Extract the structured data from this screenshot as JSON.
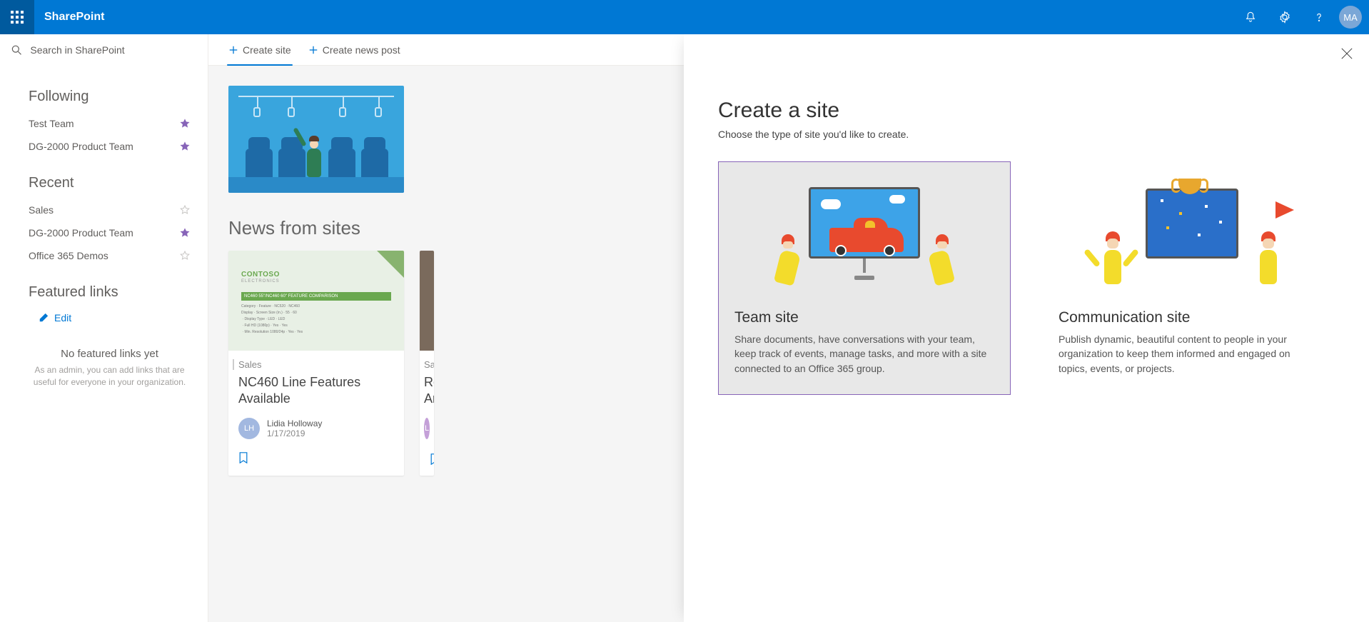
{
  "suitebar": {
    "brand": "SharePoint",
    "avatar_initials": "MA"
  },
  "search": {
    "placeholder": "Search in SharePoint"
  },
  "nav": {
    "following_heading": "Following",
    "recent_heading": "Recent",
    "featured_heading": "Featured links",
    "edit_label": "Edit",
    "following": [
      {
        "label": "Test Team",
        "starred": true
      },
      {
        "label": "DG-2000 Product Team",
        "starred": true
      }
    ],
    "recent": [
      {
        "label": "Sales",
        "starred": false
      },
      {
        "label": "DG-2000 Product Team",
        "starred": true
      },
      {
        "label": "Office 365 Demos",
        "starred": false
      }
    ],
    "nofeatured_title": "No featured links yet",
    "nofeatured_body": "As an admin, you can add links that are useful for everyone in your organization."
  },
  "commands": {
    "create_site": "Create site",
    "create_news": "Create news post"
  },
  "news": {
    "heading": "News from sites",
    "card1": {
      "thumb_logo": "CONTOSO",
      "thumb_sub": "ELECTRONICS",
      "thumb_band": "NC460 55\"/NC460 60\" FEATURE COMPARISON",
      "site": "Sales",
      "title": "NC460 Line Features Available",
      "author": "Lidia Holloway",
      "author_initials": "LH",
      "date": "1/17/2019"
    },
    "card2": {
      "site": "Sa",
      "title_frag1": "Re",
      "title_frag2": "Ar"
    }
  },
  "panel": {
    "title": "Create a site",
    "subtitle": "Choose the type of site you'd like to create.",
    "team": {
      "title": "Team site",
      "desc": "Share documents, have conversations with your team, keep track of events, manage tasks, and more with a site connected to an Office 365 group."
    },
    "comm": {
      "title": "Communication site",
      "desc": "Publish dynamic, beautiful content to people in your organization to keep them informed and engaged on topics, events, or projects."
    }
  }
}
